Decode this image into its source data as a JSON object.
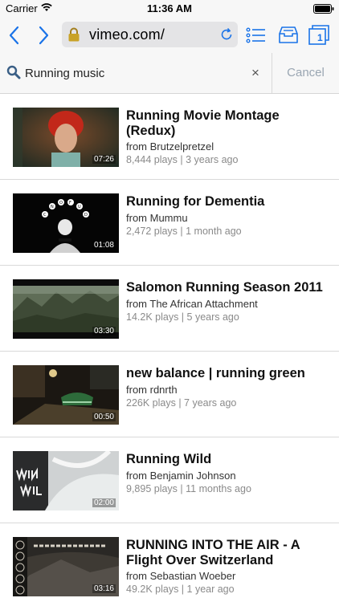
{
  "status_bar": {
    "carrier": "Carrier",
    "time": "11:36 AM"
  },
  "toolbar": {
    "url": "vimeo.com/",
    "tab_count": "1",
    "accent_color": "#1a73e8"
  },
  "search": {
    "query": "Running music",
    "clear_label": "×",
    "cancel_label": "Cancel"
  },
  "results": [
    {
      "title": "Running Movie Montage (Redux)",
      "author": "from Brutzelpretzel",
      "meta": "8,444 plays | 3 years ago",
      "duration": "07:26"
    },
    {
      "title": "Running for Dementia",
      "author": "from Mummu",
      "meta": "2,472 plays | 1 month ago",
      "duration": "01:08"
    },
    {
      "title": "Salomon Running Season 2011",
      "author": "from The African Attachment",
      "meta": "14.2K plays | 5 years ago",
      "duration": "03:30"
    },
    {
      "title": "new balance | running green",
      "author": "from rdnrth",
      "meta": "226K plays | 7 years ago",
      "duration": "00:50"
    },
    {
      "title": "Running Wild",
      "author": "from Benjamin Johnson",
      "meta": "9,895 plays | 11 months ago",
      "duration": "02:00"
    },
    {
      "title": "RUNNING INTO THE AIR - A Flight Over Switzerland",
      "author": "from Sebastian Woeber",
      "meta": "49.2K plays | 1 year ago",
      "duration": "03:16"
    }
  ]
}
